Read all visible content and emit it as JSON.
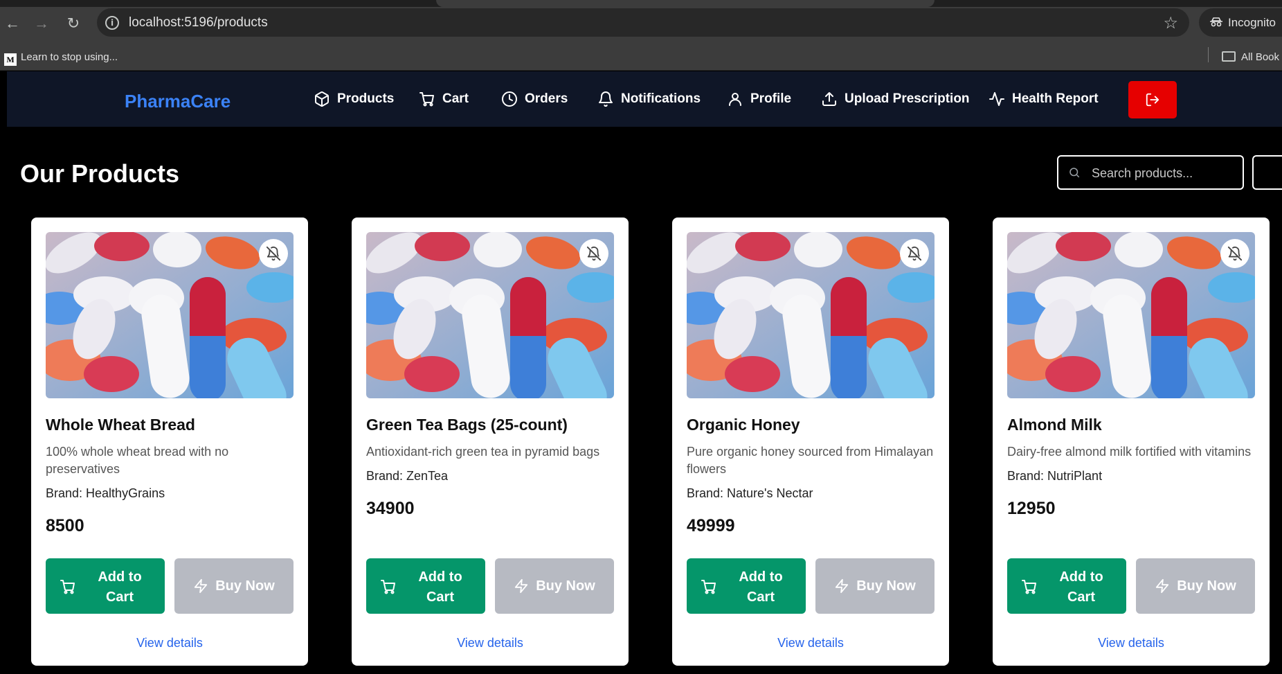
{
  "browser": {
    "url": "localhost:5196/products",
    "incognito_label": "Incognito",
    "bookmark_label": "Learn to stop using...",
    "bookmark_favicon": "M",
    "all_bookmarks_label": "All Book"
  },
  "nav": {
    "brand": "PharmaCare",
    "brand_color": "#3b82f6",
    "items": [
      {
        "label": "Products",
        "icon": "box-icon"
      },
      {
        "label": "Cart",
        "icon": "cart-icon"
      },
      {
        "label": "Orders",
        "icon": "clock-icon"
      },
      {
        "label": "Notifications",
        "icon": "bell-icon"
      },
      {
        "label": "Profile",
        "icon": "user-icon"
      },
      {
        "label": "Upload Prescription",
        "icon": "upload-icon"
      },
      {
        "label": "Health Report",
        "icon": "activity-icon"
      }
    ],
    "logout_icon": "logout-icon",
    "logout_color": "#e60000"
  },
  "page": {
    "title": "Our Products",
    "search_placeholder": "Search products..."
  },
  "products": [
    {
      "name": "Whole Wheat Bread",
      "description": "100% whole wheat bread with no preservatives",
      "brand": "Brand: HealthyGrains",
      "price": "8500",
      "add_label": "Add to Cart",
      "buy_label": "Buy Now",
      "details_label": "View details"
    },
    {
      "name": "Green Tea Bags (25-count)",
      "description": "Antioxidant-rich green tea in pyramid bags",
      "brand": "Brand: ZenTea",
      "price": "34900",
      "add_label": "Add to Cart",
      "buy_label": "Buy Now",
      "details_label": "View details"
    },
    {
      "name": "Organic Honey",
      "description": "Pure organic honey sourced from Himalayan flowers",
      "brand": "Brand: Nature's Nectar",
      "price": "49999",
      "add_label": "Add to Cart",
      "buy_label": "Buy Now",
      "details_label": "View details"
    },
    {
      "name": "Almond Milk",
      "description": "Dairy-free almond milk fortified with vitamins",
      "brand": "Brand: NutriPlant",
      "price": "12950",
      "add_label": "Add to Cart",
      "buy_label": "Buy Now",
      "details_label": "View details"
    }
  ],
  "colors": {
    "add_button": "#05966a",
    "buy_button": "#b7bac2",
    "link": "#2563eb"
  }
}
